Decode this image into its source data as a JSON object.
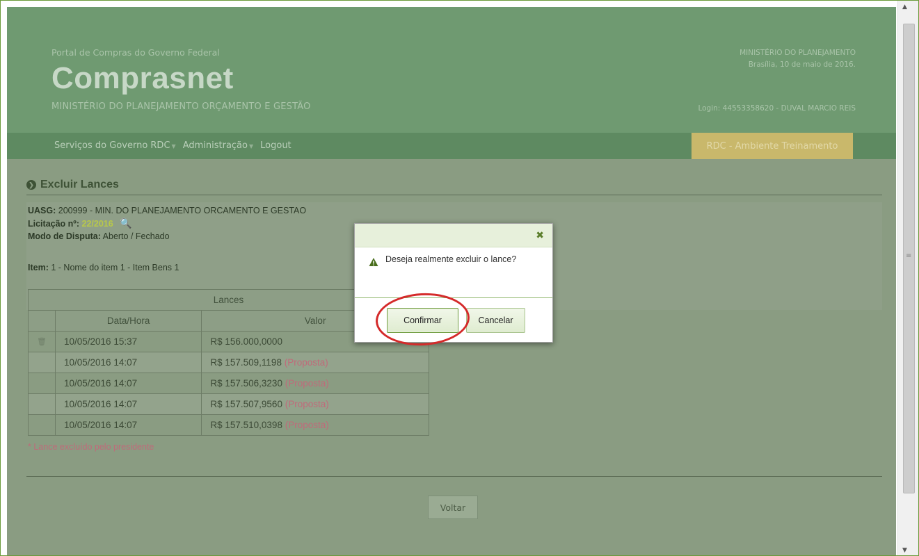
{
  "header": {
    "portal_label": "Portal de Compras do Governo Federal",
    "brand": "Comprasnet",
    "ministry_sub": "MINISTÉRIO DO PLANEJAMENTO ORÇAMENTO E GESTÃO",
    "right_ministry": "MINISTÉRIO DO PLANEJAMENTO",
    "right_date": "Brasília, 10 de maio de 2016.",
    "login": "Login: 44553358620 - DUVAL MARCIO REIS"
  },
  "nav": {
    "items": [
      {
        "label": "Serviços do Governo RDC",
        "has_caret": true
      },
      {
        "label": "Administração",
        "has_caret": true
      },
      {
        "label": "Logout",
        "has_caret": false
      }
    ],
    "environment": "RDC - Ambiente Treinamento"
  },
  "page": {
    "title": "Excluir Lances",
    "uasg_label": "UASG:",
    "uasg_value": "200999 - MIN. DO PLANEJAMENTO ORCAMENTO E GESTAO",
    "licitacao_label": "Licitação nº:",
    "licitacao_value": "22/2016",
    "modo_label": "Modo de Disputa:",
    "modo_value": "Aberto / Fechado",
    "item_label": "Item:",
    "item_value": "1 - Nome do item 1 - Item Bens 1"
  },
  "table": {
    "caption": "Lances",
    "columns": [
      "Data/Hora",
      "Valor"
    ],
    "rows": [
      {
        "data_hora": "10/05/2016 15:37",
        "valor": "R$ 156.000,0000",
        "tag": "",
        "deletable": true
      },
      {
        "data_hora": "10/05/2016 14:07",
        "valor": "R$ 157.509,1198",
        "tag": "(Proposta)",
        "deletable": false
      },
      {
        "data_hora": "10/05/2016 14:07",
        "valor": "R$ 157.506,3230",
        "tag": "(Proposta)",
        "deletable": false
      },
      {
        "data_hora": "10/05/2016 14:07",
        "valor": "R$ 157.507,9560",
        "tag": "(Proposta)",
        "deletable": false
      },
      {
        "data_hora": "10/05/2016 14:07",
        "valor": "R$ 157.510,0398",
        "tag": "(Proposta)",
        "deletable": false
      }
    ],
    "note": "* Lance excluído pelo presidente"
  },
  "actions": {
    "voltar": "Voltar"
  },
  "dialog": {
    "message": "Deseja realmente excluir o lance?",
    "confirm": "Confirmar",
    "cancel": "Cancelar",
    "close_symbol": "✖"
  },
  "colors": {
    "header_bg": "#6f9a71",
    "accent_green": "#6d9b3c",
    "highlight_red": "#d42a2a",
    "env_badge": "#c9b86b"
  }
}
